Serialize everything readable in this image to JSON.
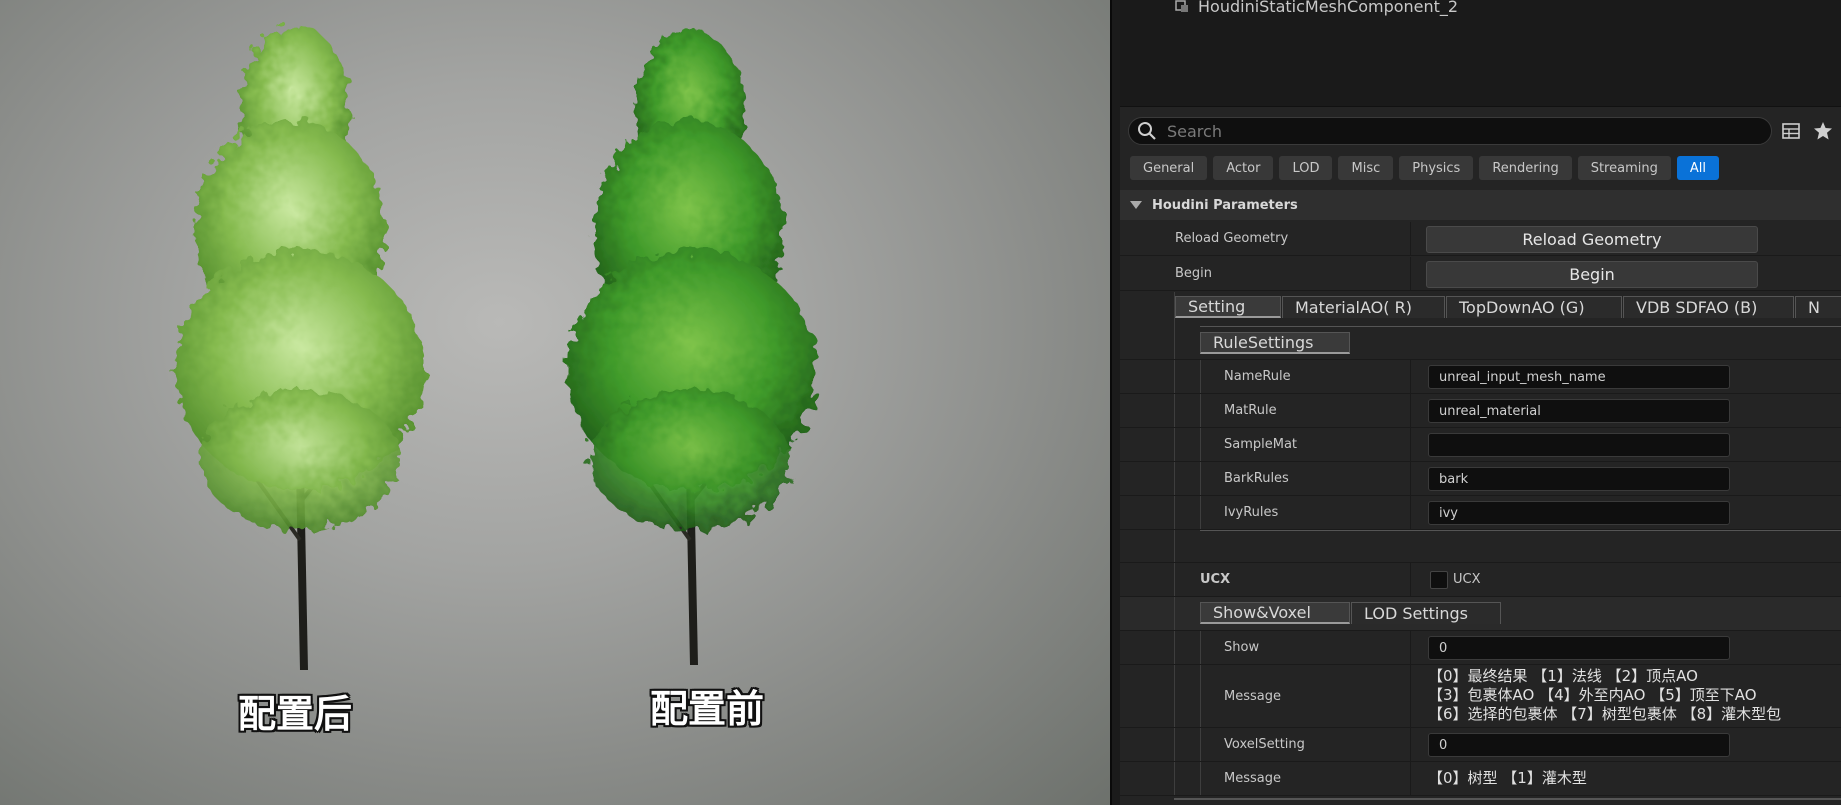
{
  "viewport": {
    "caption_left": "配置后",
    "caption_right": "配置前"
  },
  "outliner": {
    "component_name": "HoudiniStaticMeshComponent_2"
  },
  "search": {
    "placeholder": "Search"
  },
  "filter_tabs": [
    "General",
    "Actor",
    "LOD",
    "Misc",
    "Physics",
    "Rendering",
    "Streaming",
    "All"
  ],
  "category": {
    "title": "Houdini Parameters"
  },
  "params": {
    "reload_label": "Reload Geometry",
    "reload_button": "Reload Geometry",
    "begin_label": "Begin",
    "begin_button": "Begin",
    "tabs": [
      "Setting",
      "MaterialAO( R)",
      "TopDownAO (G)",
      "VDB SDFAO (B)",
      "N"
    ],
    "rule_settings_tab": "RuleSettings",
    "name_rule": {
      "label": "NameRule",
      "value": "unreal_input_mesh_name"
    },
    "mat_rule": {
      "label": "MatRule",
      "value": "unreal_material"
    },
    "sample_mat": {
      "label": "SampleMat",
      "value": ""
    },
    "bark_rules": {
      "label": "BarkRules",
      "value": "bark"
    },
    "ivy_rules": {
      "label": "IvyRules",
      "value": "ivy"
    },
    "ucx": {
      "label": "UCX",
      "checkbox_label": "UCX",
      "checked": false
    },
    "show_tabs": [
      "Show&Voxel",
      "LOD Settings"
    ],
    "show": {
      "label": "Show",
      "value": "0"
    },
    "message1": {
      "label": "Message",
      "lines": [
        "【0】最终结果 【1】法线 【2】顶点AO",
        "【3】包裹体AO 【4】外至内AO 【5】顶至下AO",
        "【6】选择的包裹体 【7】树型包裹体 【8】灌木型包"
      ]
    },
    "voxel_setting": {
      "label": "VoxelSetting",
      "value": "0"
    },
    "message2": {
      "label": "Message",
      "lines": [
        "【0】树型 【1】灌木型"
      ]
    }
  },
  "colors": {
    "active_tab": "#0a72d8",
    "panel_bg": "#242424"
  }
}
